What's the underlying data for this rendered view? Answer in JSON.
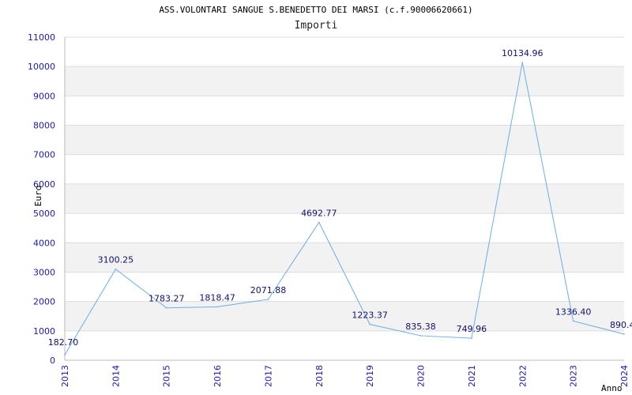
{
  "header": {
    "title": "ASS.VOLONTARI SANGUE S.BENEDETTO DEI MARSI (c.f.90006620661)",
    "subtitle": "Importi"
  },
  "chart_data": {
    "type": "line",
    "title": "ASS.VOLONTARI SANGUE S.BENEDETTO DEI MARSI (c.f.90006620661)",
    "subtitle": "Importi",
    "xlabel": "Anno",
    "ylabel": "Euro",
    "ylim": [
      0,
      11000
    ],
    "yticks": [
      "0",
      "1000",
      "2000",
      "3000",
      "4000",
      "5000",
      "6000",
      "7000",
      "8000",
      "9000",
      "10000",
      "11000"
    ],
    "categories": [
      "2013",
      "2014",
      "2015",
      "2016",
      "2017",
      "2018",
      "2019",
      "2020",
      "2021",
      "2022",
      "2023",
      "2024"
    ],
    "series": [
      {
        "values": [
          182.7,
          3100.25,
          1783.27,
          1818.47,
          2071.88,
          4692.77,
          1223.37,
          835.38,
          749.96,
          10134.96,
          1336.4,
          890.4
        ],
        "labels": [
          "182.70",
          "3100.25",
          "1783.27",
          "1818.47",
          "2071.88",
          "4692.77",
          "1223.37",
          "835.38",
          "749.96",
          "10134.96",
          "1336.40",
          "890.4"
        ]
      }
    ],
    "grid": true,
    "colors": {
      "line": "#6aaee8",
      "band": "#f2f2f2",
      "gridline": "#dddddd",
      "tick_text": "#1a1aa8",
      "data_label": "#10106b"
    }
  }
}
